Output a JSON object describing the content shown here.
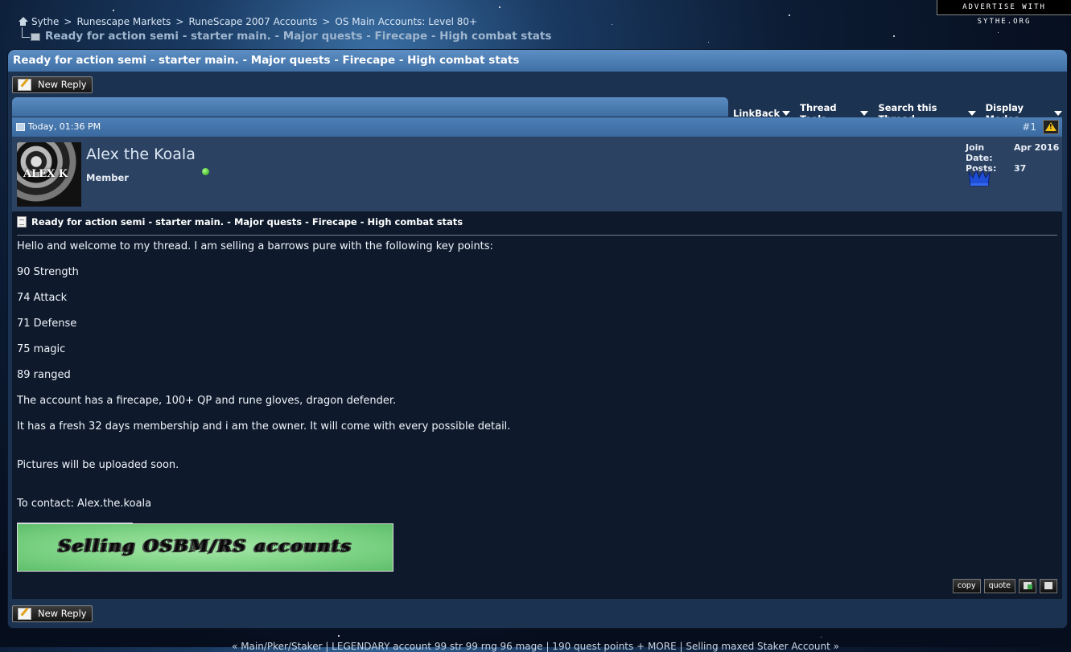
{
  "advertise_label": "ADVERTISE WITH SYTHE.ORG",
  "breadcrumb": {
    "items": [
      "Sythe",
      "Runescape Markets",
      "RuneScape 2007 Accounts",
      "OS Main Accounts: Level 80+"
    ],
    "separator": ">",
    "current": "Ready for action semi - starter main. - Major quests - Firecape - High combat stats"
  },
  "thread": {
    "title": "Ready for action semi - starter main. - Major quests - Firecape - High combat stats",
    "new_reply_label": "New Reply"
  },
  "toolbar": {
    "items": [
      "LinkBack",
      "Thread Tools",
      "Search this Thread",
      "Display Modes"
    ]
  },
  "post": {
    "date": "Today, 01:36 PM",
    "number": "#1",
    "user": {
      "name": "Alex the Koala",
      "title": "Member",
      "avatar_text": "ALEX K",
      "join_date_label": "Join Date:",
      "join_date": "Apr 2016",
      "posts_label": "Posts:",
      "posts": "37",
      "status": "online"
    },
    "title": "Ready for action semi - starter main. - Major quests - Firecape - High combat stats",
    "lines": [
      "Hello and welcome to my thread. I am selling a barrows pure with the following key points:",
      "90 Strength",
      "74 Attack",
      "71 Defense",
      "75 magic",
      "89 ranged",
      "The account has a firecape, 100+ QP and rune gloves, dragon defender.",
      "It has a fresh 32 days membership and i am the owner. It will come with every possible detail.",
      "Pictures will be uploaded soon.",
      "To contact: Alex.the.koala"
    ],
    "signature_banner": "Selling OSBM/RS accounts",
    "actions": {
      "copy": "copy",
      "quote": "quote"
    }
  },
  "bottom_nav": {
    "prev": "« Main/Pker/Staker | LEGENDARY account 99 str 99 rng 96 mage | 190 quest points + MORE",
    "sep": "|",
    "next": "Selling maxed Staker Account »"
  },
  "colors": {
    "header_blue": "#4d7fb6",
    "panel": "#1b3251",
    "post_body": "#0e1a2c",
    "online": "#28a01a"
  }
}
